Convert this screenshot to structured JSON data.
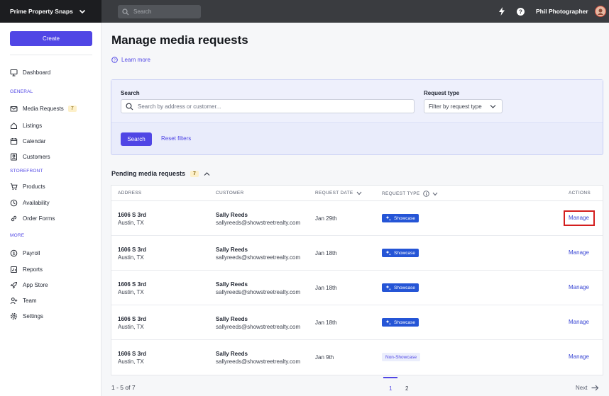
{
  "topbar": {
    "brand": "Prime Property Snaps",
    "search_placeholder": "Search",
    "user_name": "Phil Photographer"
  },
  "sidebar": {
    "create_label": "Create",
    "dashboard": "Dashboard",
    "section_general": "GENERAL",
    "media_requests": "Media Requests",
    "media_requests_count": "7",
    "listings": "Listings",
    "calendar": "Calendar",
    "customers": "Customers",
    "section_storefront": "STOREFRONT",
    "products": "Products",
    "availability": "Availability",
    "order_forms": "Order Forms",
    "section_more": "MORE",
    "payroll": "Payroll",
    "reports": "Reports",
    "app_store": "App Store",
    "team": "Team",
    "settings": "Settings"
  },
  "main": {
    "title": "Manage media requests",
    "learn_more": "Learn more",
    "filters": {
      "search_label": "Search",
      "search_placeholder": "Search by address or customer...",
      "type_label": "Request type",
      "type_value": "Filter by request type",
      "search_button": "Search",
      "reset_link": "Reset filters"
    },
    "pending": {
      "title": "Pending media requests",
      "count": "7"
    },
    "table": {
      "headers": {
        "address": "ADDRESS",
        "customer": "CUSTOMER",
        "date": "REQUEST DATE",
        "type": "REQUEST TYPE",
        "actions": "ACTIONS"
      },
      "rows": [
        {
          "addr1": "1606 S 3rd",
          "addr2": "Austin, TX",
          "name": "Sally Reeds",
          "email": "sallyreeds@showstreetrealty.com",
          "date": "Jan 29th",
          "type": "Showcase",
          "action": "Manage"
        },
        {
          "addr1": "1606 S 3rd",
          "addr2": "Austin, TX",
          "name": "Sally Reeds",
          "email": "sallyreeds@showstreetrealty.com",
          "date": "Jan 18th",
          "type": "Showcase",
          "action": "Manage"
        },
        {
          "addr1": "1606 S 3rd",
          "addr2": "Austin, TX",
          "name": "Sally Reeds",
          "email": "sallyreeds@showstreetrealty.com",
          "date": "Jan 18th",
          "type": "Showcase",
          "action": "Manage"
        },
        {
          "addr1": "1606 S 3rd",
          "addr2": "Austin, TX",
          "name": "Sally Reeds",
          "email": "sallyreeds@showstreetrealty.com",
          "date": "Jan 18th",
          "type": "Showcase",
          "action": "Manage"
        },
        {
          "addr1": "1606 S 3rd",
          "addr2": "Austin, TX",
          "name": "Sally Reeds",
          "email": "sallyreeds@showstreetrealty.com",
          "date": "Jan 9th",
          "type": "Non-Showcase",
          "action": "Manage"
        }
      ]
    },
    "pagination": {
      "info": "1 - 5 of 7",
      "page1": "1",
      "page2": "2",
      "next": "Next"
    }
  },
  "colors": {
    "accent": "#5046e5",
    "showcase_badge": "#2555d6",
    "highlight": "#d41e1e"
  }
}
